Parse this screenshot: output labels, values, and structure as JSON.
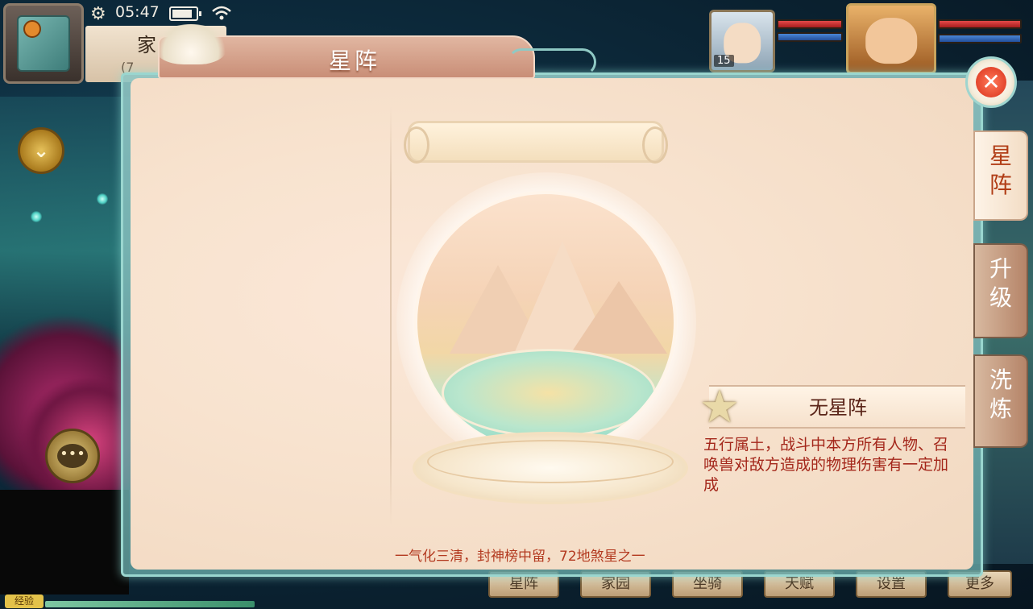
{
  "status_bar": {
    "time": "05:47"
  },
  "hud": {
    "home_label": "家",
    "home_sub": "(7",
    "exp_label": "经验"
  },
  "party": [
    {
      "level": "15"
    },
    {
      "level": ""
    }
  ],
  "dialog": {
    "title": "星阵",
    "close_glyph": "✕"
  },
  "side_tabs": [
    {
      "label": "星\n阵",
      "active": true
    },
    {
      "label": "升\n级",
      "active": false
    },
    {
      "label": "洗\n炼",
      "active": false
    }
  ],
  "star_formation": {
    "name": "无星阵",
    "description": "五行属土，战斗中本方所有人物、召唤兽对敌方造成的物理伤害有一定加成",
    "verse": "一气化三清，封神榜中留，72地煞星之一"
  },
  "bottom_menu": [
    {
      "label": "星阵"
    },
    {
      "label": "家园"
    },
    {
      "label": "坐骑"
    },
    {
      "label": "天赋"
    },
    {
      "label": "设置"
    },
    {
      "label": "更多"
    }
  ],
  "colors": {
    "accent_red": "#a4271b",
    "panel_bg": "#f8e3cf",
    "frame_teal": "#9ad6cf"
  },
  "icons": {
    "map": "map-icon",
    "settings": "gear-icon",
    "battery": "battery-icon",
    "wifi": "wifi-icon",
    "expand": "chevron-down-icon",
    "chat": "chat-icon",
    "close": "close-icon",
    "star": "star-icon"
  }
}
